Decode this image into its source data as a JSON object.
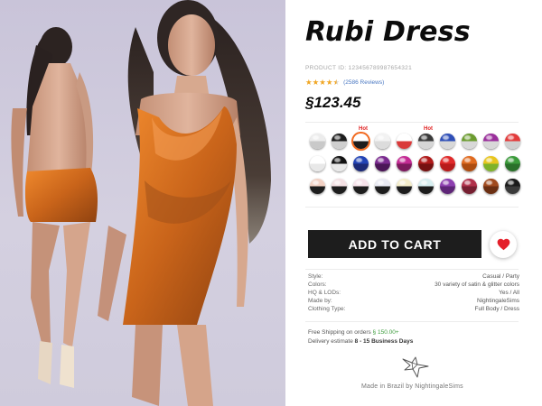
{
  "product": {
    "title": "Rubi Dress",
    "id_label": "PRODUCT ID: 123456789987654321",
    "rating": 4.5,
    "reviews": "(2586 Reviews)",
    "price": "§123.45"
  },
  "swatches": {
    "row1": [
      {
        "color": "#ececec",
        "shade": "#c9c9c9"
      },
      {
        "color": "#1d1d1d",
        "shade": "#cfcfcf"
      },
      {
        "color": "#ffffff",
        "shade": "#1d1d1d",
        "hot": "Hot",
        "selected": true
      },
      {
        "color": "#f2f2f2",
        "shade": "#dcdcdc"
      },
      {
        "color": "#ffffff",
        "shade": "#d93a3a"
      },
      {
        "color": "#3a3a3a",
        "shade": "#d6d6d6",
        "hot": "Hot"
      },
      {
        "color": "#2f4fb7",
        "shade": "#d8d8d8"
      },
      {
        "color": "#6b9b2f",
        "shade": "#d8d8d8"
      },
      {
        "color": "#9a2f9b",
        "shade": "#d8d8d8"
      },
      {
        "color": "#e23b3b",
        "shade": "#cfcfcf"
      }
    ],
    "row2": [
      {
        "color": "#ffffff",
        "shade": "#e8e8e8"
      },
      {
        "color": "#111111",
        "shade": "#e9e9e9"
      },
      {
        "color": "#2143b5",
        "shade": "#1c2a77"
      },
      {
        "color": "#7a2a8f",
        "shade": "#4b1657"
      },
      {
        "color": "#c42a94",
        "shade": "#7c1a5d"
      },
      {
        "color": "#b01a1a",
        "shade": "#751111"
      },
      {
        "color": "#e02a2a",
        "shade": "#b71b1b"
      },
      {
        "color": "#e06a1e",
        "shade": "#ad4c10"
      },
      {
        "color": "#e8c51d",
        "shade": "#7fb22a"
      },
      {
        "color": "#3b9b3b",
        "shade": "#2a702a"
      }
    ],
    "row3": [
      {
        "color": "#f2d1c4",
        "shade": "#1d1d1d"
      },
      {
        "color": "#f3e0e3",
        "shade": "#1d1d1d"
      },
      {
        "color": "#f6e2ea",
        "shade": "#1d1d1d"
      },
      {
        "color": "#e9eaf3",
        "shade": "#1d1d1d"
      },
      {
        "color": "#f3ecc9",
        "shade": "#1d1d1d"
      },
      {
        "color": "#d6eef0",
        "shade": "#1d1d1d"
      },
      {
        "color": "#8d3fb0",
        "shade": "#5e2577"
      },
      {
        "color": "#b0304a",
        "shade": "#761f31"
      },
      {
        "color": "#a04a1e",
        "shade": "#6b2f12"
      },
      {
        "color": "#1a1a1a",
        "shade": "#3a3a3a"
      }
    ]
  },
  "actions": {
    "add_to_cart": "ADD TO CART"
  },
  "specs": [
    {
      "label": "Style:",
      "value": "Casual / Party"
    },
    {
      "label": "Colors:",
      "value": "30 variety of satin & glitter colors"
    },
    {
      "label": "HQ & LODs:",
      "value": "Yes / All"
    },
    {
      "label": "Made by:",
      "value": "NightingaleSims"
    },
    {
      "label": "Clothing Type:",
      "value": "Full Body / Dress"
    }
  ],
  "shipping": {
    "line1_prefix": "Free Shipping on orders ",
    "line1_amount": "§ 150.00+",
    "line2_prefix": "Delivery estimate ",
    "line2_value": "8 - 15 Business Days"
  },
  "footer": {
    "made_in": "Made in Brazil by NightingaleSims"
  },
  "icons": {
    "heart": "heart-icon",
    "logo": "nightingale-bird-logo"
  },
  "colors": {
    "accent_orange": "#f26a20",
    "heart_red": "#e41f2a",
    "button_dark": "#1d1d1d",
    "dress_orange": "#d0701f"
  }
}
